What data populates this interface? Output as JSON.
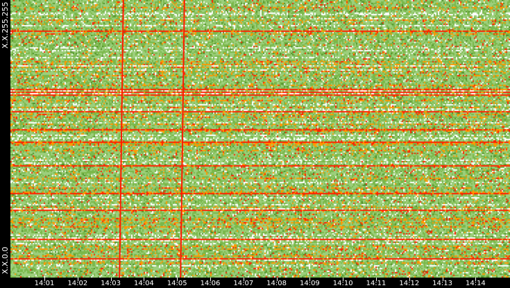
{
  "chart_data": {
    "type": "heatmap",
    "title": "",
    "xlabel": "",
    "ylabel": "",
    "x_ticks": [
      "14:01",
      "14:02",
      "14:03",
      "14:04",
      "14:05",
      "14:06",
      "14:07",
      "14:08",
      "14:09",
      "14:10",
      "14:11",
      "14:12",
      "14:13",
      "14:14"
    ],
    "x_range_minutes": [
      0.35,
      15.4
    ],
    "y_labels": {
      "top": "X.X.255.255",
      "bottom": "X.X.0.0"
    },
    "vertical_events_minutes": [
      3.3,
      5.15
    ],
    "color_scale": [
      "#ffffff",
      "#9ccf7c",
      "#7ab84a",
      "#4e8f2a",
      "#ff9900",
      "#ff2200"
    ],
    "grid": false
  }
}
